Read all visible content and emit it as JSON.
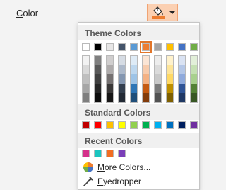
{
  "property": {
    "label_first": "C",
    "label_rest": "olor"
  },
  "fill_button": {
    "current_color": "#ed7d31"
  },
  "picker": {
    "theme_header": "Theme Colors",
    "standard_header": "Standard Colors",
    "recent_header": "Recent Colors",
    "more_colors": {
      "first": "M",
      "rest": "ore Colors..."
    },
    "eyedropper": {
      "first": "E",
      "rest": "yedropper"
    },
    "theme_colors": [
      "#ffffff",
      "#000000",
      "#e7e6e6",
      "#44546a",
      "#5b9bd5",
      "#ed7d31",
      "#a5a5a5",
      "#ffc000",
      "#4472c4",
      "#70ad47"
    ],
    "theme_shades": [
      [
        "#f2f2f2",
        "#d9d9d9",
        "#bfbfbf",
        "#a6a6a6",
        "#7f7f7f"
      ],
      [
        "#7f7f7f",
        "#595959",
        "#404040",
        "#262626",
        "#0d0d0d"
      ],
      [
        "#d0cece",
        "#aeabab",
        "#757171",
        "#3a3838",
        "#171616"
      ],
      [
        "#d6dce4",
        "#adb9ca",
        "#8496b0",
        "#333f4f",
        "#222a35"
      ],
      [
        "#deebf6",
        "#bdd7ee",
        "#9dc3e6",
        "#2e75b5",
        "#1f4e79"
      ],
      [
        "#fbe5d5",
        "#f7cbac",
        "#f4b183",
        "#c55a11",
        "#833c0b"
      ],
      [
        "#ededed",
        "#dbdbdb",
        "#c9c9c9",
        "#7b7b7b",
        "#525252"
      ],
      [
        "#fff2cc",
        "#fee599",
        "#ffd965",
        "#bf9000",
        "#7f6000"
      ],
      [
        "#dae3f3",
        "#b4c7e7",
        "#8faadc",
        "#2f5496",
        "#1f3864"
      ],
      [
        "#e2efd9",
        "#c5e0b3",
        "#a8d08d",
        "#538135",
        "#375623"
      ]
    ],
    "selected_index": 5,
    "standard_colors": [
      "#c00000",
      "#ff0000",
      "#ffc000",
      "#ffff00",
      "#92d050",
      "#00b050",
      "#00b0f0",
      "#0070c0",
      "#002060",
      "#7030a0"
    ],
    "recent_colors": [
      "#d5328b",
      "#1bc5c0",
      "#f16d22",
      "#7a3fb8"
    ]
  }
}
